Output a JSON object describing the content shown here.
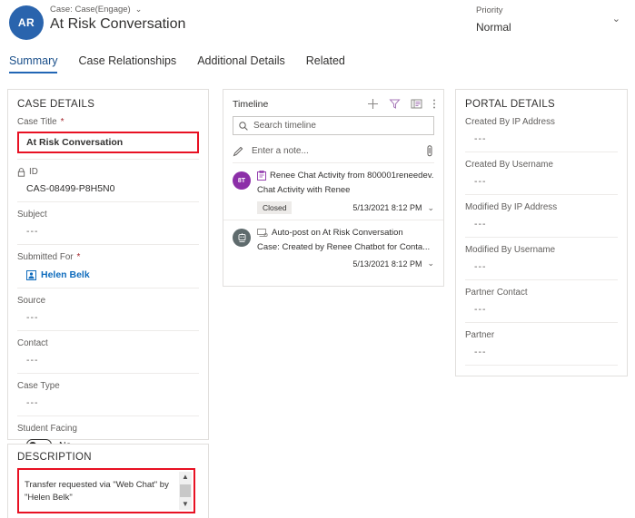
{
  "header": {
    "avatar_initials": "AR",
    "entity_label": "Case: Case(Engage)",
    "record_title": "At Risk Conversation",
    "priority_label": "Priority",
    "priority_value": "Normal",
    "avatar_color": "#2A64AD"
  },
  "tabs": [
    {
      "label": "Summary",
      "active": true
    },
    {
      "label": "Case Relationships",
      "active": false
    },
    {
      "label": "Additional Details",
      "active": false
    },
    {
      "label": "Related",
      "active": false
    }
  ],
  "case_details": {
    "section_title": "CASE DETAILS",
    "fields": [
      {
        "label": "Case Title",
        "required": true,
        "value": "At Risk Conversation",
        "highlight": true
      },
      {
        "label": "ID",
        "required": false,
        "value": "CAS-08499-P8H5N0",
        "locked": true
      },
      {
        "label": "Subject",
        "required": false,
        "value": "---"
      },
      {
        "label": "Submitted For",
        "required": true,
        "value": "Helen Belk",
        "link": true
      },
      {
        "label": "Source",
        "required": false,
        "value": "---"
      },
      {
        "label": "Contact",
        "required": false,
        "value": "---"
      },
      {
        "label": "Case Type",
        "required": false,
        "value": "---"
      }
    ],
    "toggle_field": {
      "label": "Student Facing",
      "value": "No",
      "on": false
    }
  },
  "description": {
    "section_title": "DESCRIPTION",
    "text": "Transfer requested via \"Web Chat\" by \"Helen Belk\""
  },
  "timeline": {
    "title": "Timeline",
    "search_placeholder": "Search timeline",
    "note_placeholder": "Enter a note...",
    "icons": [
      "add-icon",
      "filter-icon",
      "sort-icon",
      "more-options-icon"
    ],
    "items": [
      {
        "avatar_initials": "8T",
        "avatar_color": "#8c2fa8",
        "icon": "chat-activity-icon",
        "line1": "Renee Chat Activity from 800001reneedev...",
        "line2": "Chat Activity with Renee",
        "badge": "Closed",
        "timestamp": "5/13/2021 8:12 PM"
      },
      {
        "avatar_initials": "",
        "avatar_color": "#5f6b6d",
        "icon": "auto-post-icon",
        "line1": "Auto-post on At Risk Conversation",
        "line2": "Case: Created by Renee Chatbot for Conta...",
        "badge": "",
        "timestamp": "5/13/2021 8:12 PM"
      }
    ]
  },
  "portal_details": {
    "section_title": "PORTAL DETAILS",
    "fields": [
      {
        "label": "Created By IP Address",
        "value": "---"
      },
      {
        "label": "Created By Username",
        "value": "---"
      },
      {
        "label": "Modified By IP Address",
        "value": "---"
      },
      {
        "label": "Modified By Username",
        "value": "---"
      },
      {
        "label": "Partner Contact",
        "value": "---"
      },
      {
        "label": "Partner",
        "value": "---"
      }
    ]
  },
  "colors": {
    "accent": "#2266b5",
    "link": "#0f6cbd",
    "required": "#a4262c",
    "highlight_box": "#e81123"
  }
}
